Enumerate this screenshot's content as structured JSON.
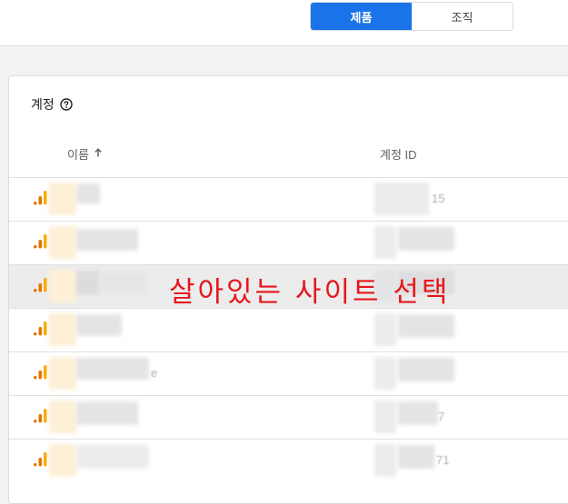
{
  "toolbar": {
    "tab_products": "제품",
    "tab_organization": "조직",
    "active_color": "#1a73e8"
  },
  "accounts": {
    "title": "계정",
    "help_icon": "help-circle-icon",
    "columns": {
      "name": "이름",
      "name_sort_icon": "arrow-up-icon",
      "id": "계정 ID"
    },
    "rows": [
      {
        "name_fragment": "",
        "id_fragment": "15",
        "product_icon": "analytics-bars-icon"
      },
      {
        "name_fragment": "",
        "id_fragment": "",
        "product_icon": "analytics-bars-icon"
      },
      {
        "name_fragment": "",
        "id_fragment": "",
        "product_icon": "analytics-bars-icon"
      },
      {
        "name_fragment": "",
        "id_fragment": "",
        "product_icon": "analytics-bars-icon"
      },
      {
        "name_fragment": "e",
        "id_fragment": "",
        "product_icon": "analytics-bars-icon"
      },
      {
        "name_fragment": "",
        "id_fragment": "7",
        "product_icon": "analytics-bars-icon"
      },
      {
        "name_fragment": "",
        "id_fragment": "71",
        "product_icon": "analytics-bars-icon"
      }
    ]
  },
  "annotation": {
    "text": "살아있는 사이트 선택",
    "color": "#e6161c"
  }
}
